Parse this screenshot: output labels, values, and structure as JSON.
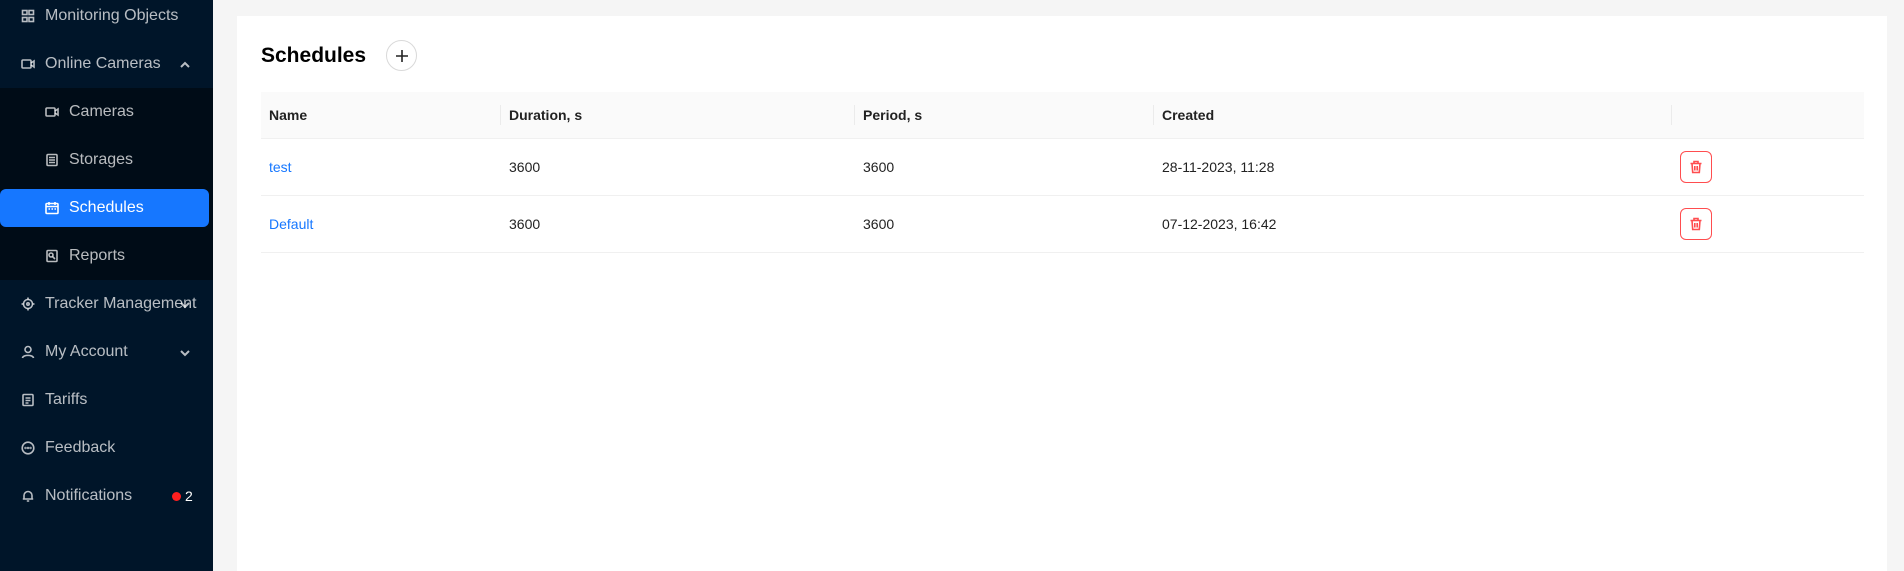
{
  "sidebar": {
    "items": [
      {
        "label": "Monitoring Objects",
        "icon": "dashboard-icon"
      },
      {
        "label": "Online Cameras",
        "icon": "video-camera-icon",
        "expanded": true
      },
      {
        "label": "Cameras",
        "icon": "video-camera-icon"
      },
      {
        "label": "Storages",
        "icon": "storage-icon"
      },
      {
        "label": "Schedules",
        "icon": "schedule-icon",
        "selected": true
      },
      {
        "label": "Reports",
        "icon": "report-icon"
      },
      {
        "label": "Tracker Management",
        "icon": "aim-icon",
        "expanded": false
      },
      {
        "label": "My Account",
        "icon": "user-icon",
        "expanded": false
      },
      {
        "label": "Tariffs",
        "icon": "tariff-icon"
      },
      {
        "label": "Feedback",
        "icon": "message-icon"
      },
      {
        "label": "Notifications",
        "icon": "bell-icon",
        "badge": "2"
      }
    ]
  },
  "page": {
    "title": "Schedules"
  },
  "table": {
    "columns": [
      "Name",
      "Duration, s",
      "Period, s",
      "Created",
      ""
    ],
    "rows": [
      {
        "name": "test",
        "duration": "3600",
        "period": "3600",
        "created": "28-11-2023, 11:28"
      },
      {
        "name": "Default",
        "duration": "3600",
        "period": "3600",
        "created": "07-12-2023, 16:42"
      }
    ]
  },
  "colors": {
    "sidebar_bg": "#001529",
    "accent": "#1677ff",
    "danger": "#ff4d4f"
  }
}
